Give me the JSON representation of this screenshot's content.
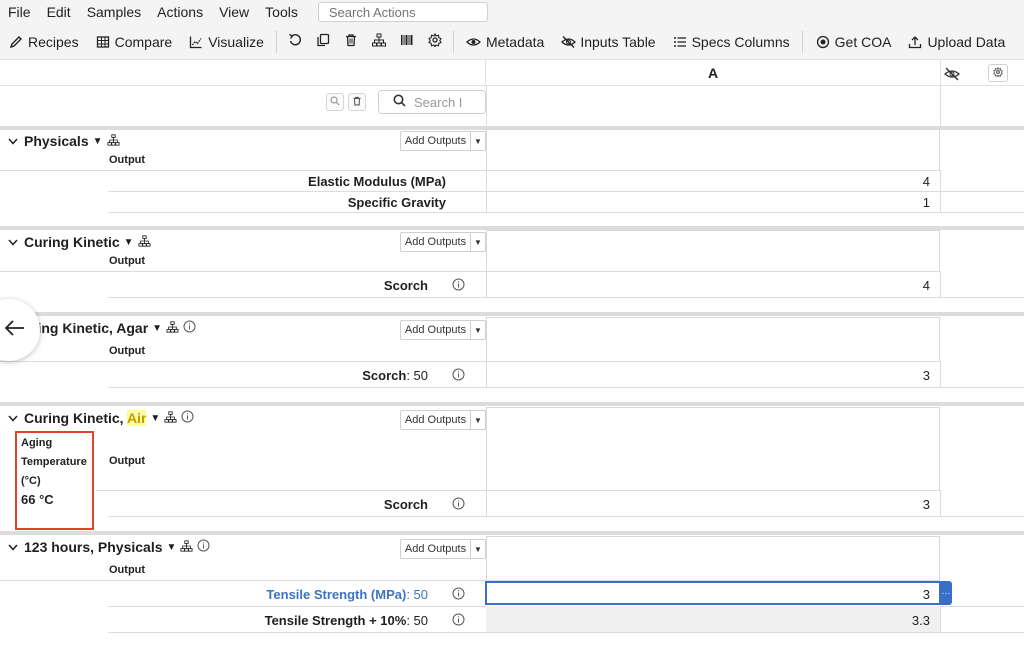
{
  "menubar": {
    "items": [
      "File",
      "Edit",
      "Samples",
      "Actions",
      "View",
      "Tools"
    ],
    "search_placeholder": "Search Actions"
  },
  "toolbar": {
    "recipes": "Recipes",
    "compare": "Compare",
    "visualize": "Visualize",
    "metadata": "Metadata",
    "inputs_table": "Inputs Table",
    "specs_columns": "Specs Columns",
    "get_coa": "Get COA",
    "upload_data": "Upload Data"
  },
  "grid": {
    "column_a": "A",
    "search_placeholder": "Search I"
  },
  "common": {
    "add_outputs": "Add Outputs",
    "output_label": "Output"
  },
  "sections": [
    {
      "title": "Physicals",
      "rows": [
        {
          "property": "Elastic Modulus (MPa)",
          "suffix": "",
          "value": "4"
        },
        {
          "property": "Specific Gravity",
          "suffix": "",
          "value": "1"
        }
      ]
    },
    {
      "title": "Curing Kinetic",
      "rows": [
        {
          "property": "Scorch",
          "suffix": "",
          "value": "4"
        }
      ]
    },
    {
      "title": "ring Kinetic, Agar",
      "rows": [
        {
          "property": "Scorch",
          "suffix": ": 50",
          "value": "3"
        }
      ]
    },
    {
      "title_prefix": "Curing Kinetic, ",
      "title_highlight": "Air",
      "condition_label": "Aging Temperature (°C)",
      "condition_value": "66 °C",
      "rows": [
        {
          "property": "Scorch",
          "suffix": "",
          "value": "3"
        }
      ]
    },
    {
      "title": "123 hours, Physicals",
      "rows": [
        {
          "property": "Tensile Strength (MPa)",
          "suffix": ": 50",
          "value": "3"
        },
        {
          "property": "Tensile Strength + 10%",
          "suffix": ": 50",
          "value": "3.3"
        }
      ]
    }
  ],
  "colors": {
    "accent_blue": "#3a6fc7",
    "highlight_yellow": "#fbff9a",
    "annotation_red": "#e0452b"
  }
}
